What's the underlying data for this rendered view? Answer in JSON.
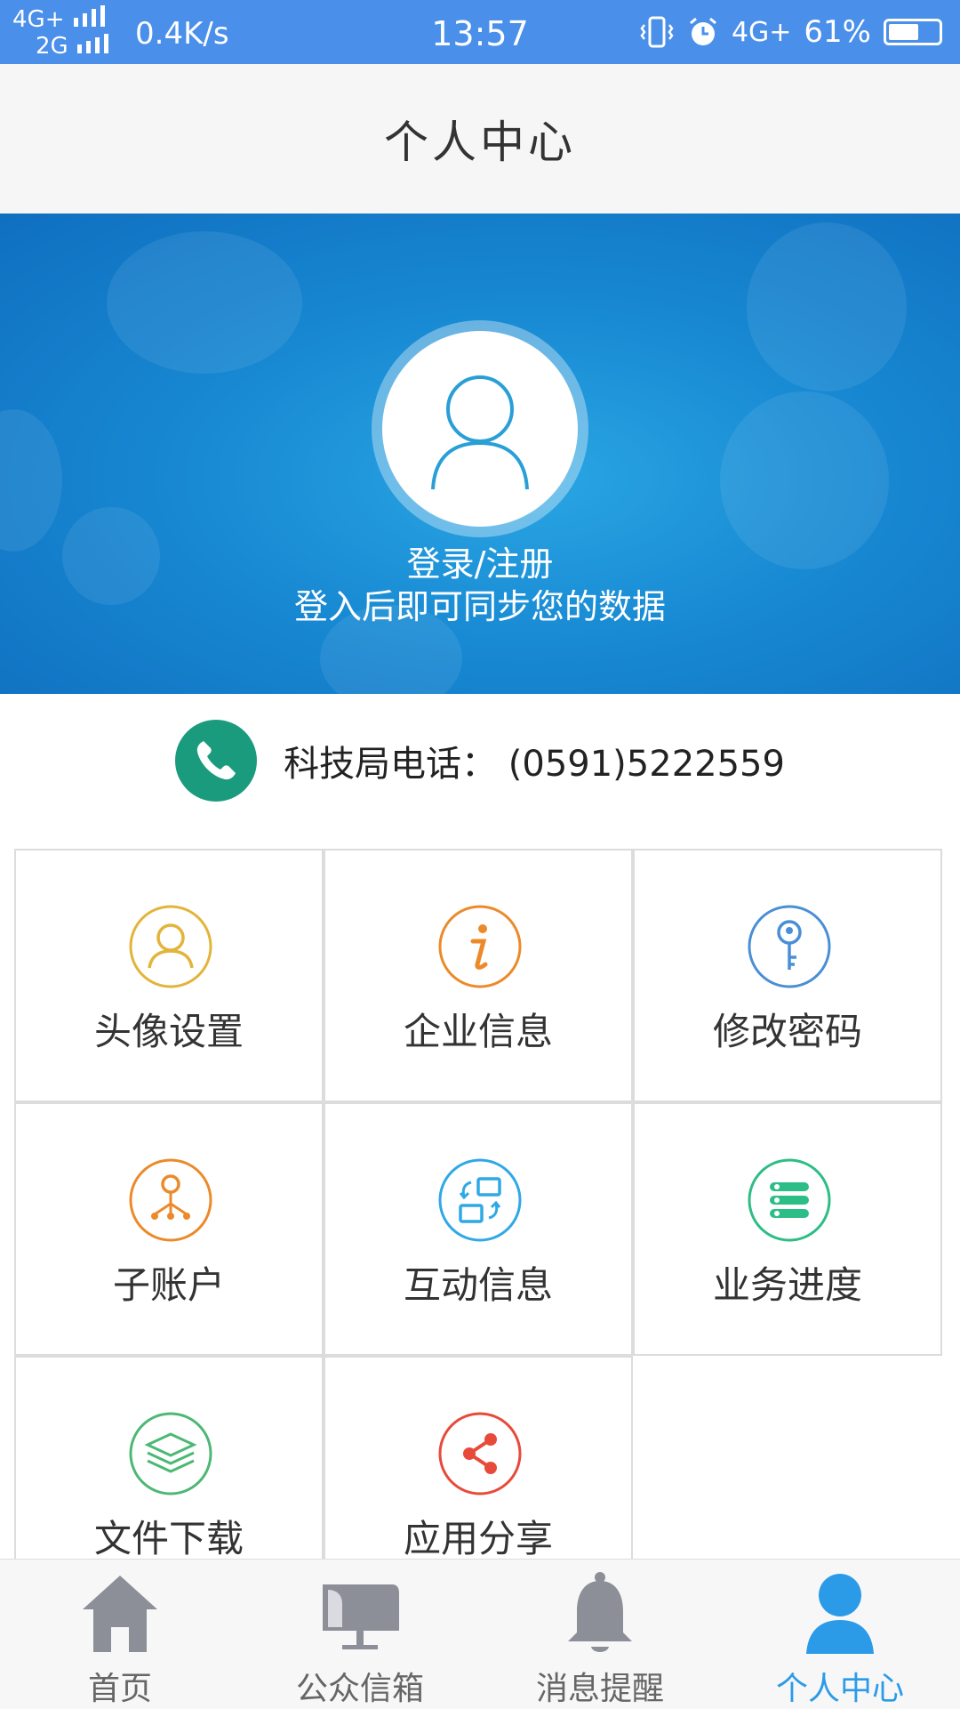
{
  "status_bar": {
    "network_top": "4G+",
    "network_bottom": "2G",
    "speed": "0.4K/s",
    "time": "13:57",
    "network_right": "4G+",
    "battery_percent_text": "61%",
    "battery_level": 0.61
  },
  "header": {
    "title": "个人中心"
  },
  "banner": {
    "login_label": "登录/注册",
    "login_hint": "登入后即可同步您的数据"
  },
  "contact": {
    "label": "科技局电话：",
    "phone": "(0591)5222559"
  },
  "menu": [
    {
      "label": "头像设置",
      "icon": "avatar-icon",
      "color": "#e3b43a"
    },
    {
      "label": "企业信息",
      "icon": "info-icon",
      "color": "#ec8a2a"
    },
    {
      "label": "修改密码",
      "icon": "key-icon",
      "color": "#4a8fd6"
    },
    {
      "label": "子账户",
      "icon": "sub-account-icon",
      "color": "#ec8a2a"
    },
    {
      "label": "互动信息",
      "icon": "interaction-icon",
      "color": "#2fa8e6"
    },
    {
      "label": "业务进度",
      "icon": "progress-icon",
      "color": "#2dbd86"
    },
    {
      "label": "文件下载",
      "icon": "layers-icon",
      "color": "#4cb874"
    },
    {
      "label": "应用分享",
      "icon": "share-icon",
      "color": "#e84a3a"
    }
  ],
  "bottom_nav": [
    {
      "label": "首页",
      "icon": "home-icon",
      "active": false
    },
    {
      "label": "公众信箱",
      "icon": "mailbox-icon",
      "active": false
    },
    {
      "label": "消息提醒",
      "icon": "bell-icon",
      "active": false
    },
    {
      "label": "个人中心",
      "icon": "person-icon",
      "active": true
    }
  ],
  "colors": {
    "status_bar": "#4a8fea",
    "banner": "#1889d3",
    "active_tab": "#2b9be8",
    "inactive_tab_icon": "#8c8f98"
  }
}
